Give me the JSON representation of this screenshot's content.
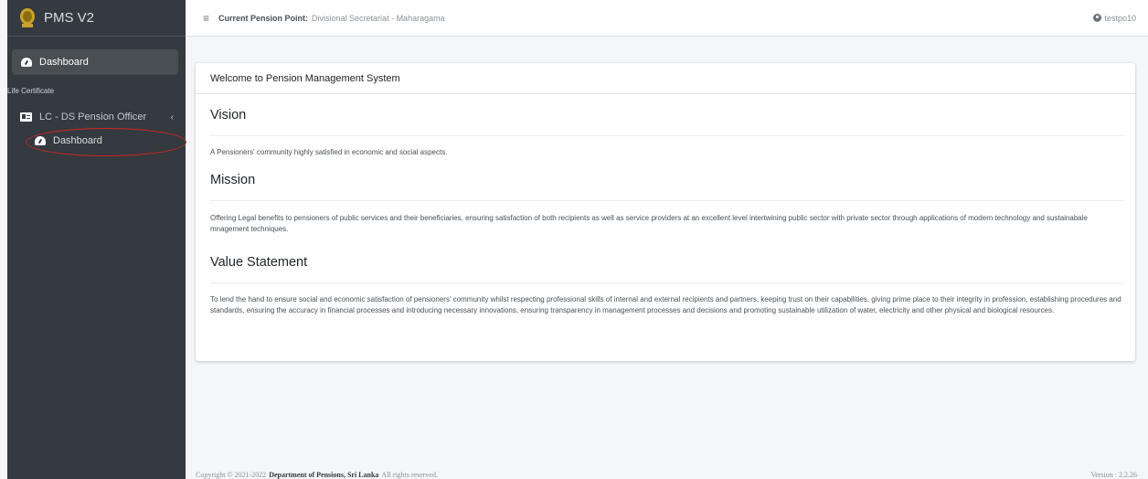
{
  "brand": {
    "title": "PMS V2",
    "logo_icon": "emblem-icon"
  },
  "sidebar": {
    "dashboard_label": "Dashboard",
    "section_header": "Life Certificate",
    "group_label": "LC - DS Pension Officer",
    "group_chevron": "‹",
    "sub_dashboard_label": "Dashboard"
  },
  "topbar": {
    "menu_glyph": "≡",
    "pension_point_label": "Current Pension Point:",
    "pension_point_value": "Divisional Secretariat - Maharagama",
    "user_name": "testpo10"
  },
  "card": {
    "header": "Welcome to Pension Management System",
    "vision_title": "Vision",
    "vision_text": "A Pensioners' community highly satisfied in economic and social aspects.",
    "mission_title": "Mission",
    "mission_text": "Offering Legal benefits to pensioners of public services and their beneficiaries, ensuring satisfaction of both recipients as well as service providers at an excellent level intertwining public sector with private sector through applications of modern technology and sustainabale mnagement techniques.",
    "value_title": "Value Statement",
    "value_text": "To lend the hand to ensure social and economic satisfaction of pensioners' community whilst respecting professional skills of internal and external recipients and partners, keeping trust on their capabilities, giving prime place to their integrity in profession, establishing procedures and standards, ensuring the accuracy in financial processes and introducing necessary innovations, ensuring transparency in management processes and decisions and promoting sustainable utilization of water, electricity and other physical and biological resources."
  },
  "footer": {
    "copyright_prefix": "Copyright © 2021-2022",
    "org": "Department of Pensions, Sri Lanka",
    "rights": "All rights reserved.",
    "version": "Version : 2.2.26"
  },
  "colors": {
    "sidebar_bg": "#343a40",
    "active_item_bg": "#494e53",
    "highlight_oval": "#d0261c",
    "content_bg": "#f4f6f9"
  }
}
